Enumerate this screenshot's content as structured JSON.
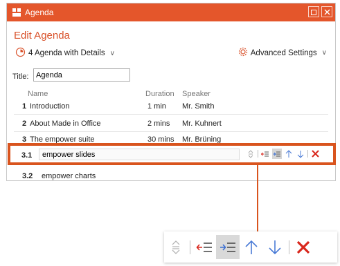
{
  "window": {
    "title": "Agenda",
    "app_icon": "agenda-app-icon"
  },
  "header": {
    "edit_title": "Edit Agenda",
    "template_label": "4 Agenda with Details",
    "advanced_label": "Advanced Settings"
  },
  "form": {
    "title_label": "Title:",
    "title_value": "Agenda"
  },
  "columns": {
    "name": "Name",
    "duration": "Duration",
    "speaker": "Speaker"
  },
  "rows": [
    {
      "num": "1",
      "name": "Introduction",
      "duration": "1 min",
      "speaker": "Mr. Smith"
    },
    {
      "num": "2",
      "name": "About Made in Office",
      "duration": "2 mins",
      "speaker": "Mr. Kuhnert"
    },
    {
      "num": "3",
      "name": "The empower suite",
      "duration": "30 mins",
      "speaker": "Mr. Brüning"
    }
  ],
  "selected_row": {
    "num": "3.1",
    "name": "empower slides"
  },
  "next_row": {
    "num": "3.2",
    "name": "empower charts"
  },
  "toolbar_icons": [
    "drag-handle-icon",
    "outdent-icon",
    "indent-icon",
    "move-up-icon",
    "move-down-icon",
    "delete-icon"
  ],
  "colors": {
    "accent": "#e4562b",
    "highlight": "#d9541e",
    "delete": "#d9271d",
    "indent_blue": "#3b6fd3"
  }
}
